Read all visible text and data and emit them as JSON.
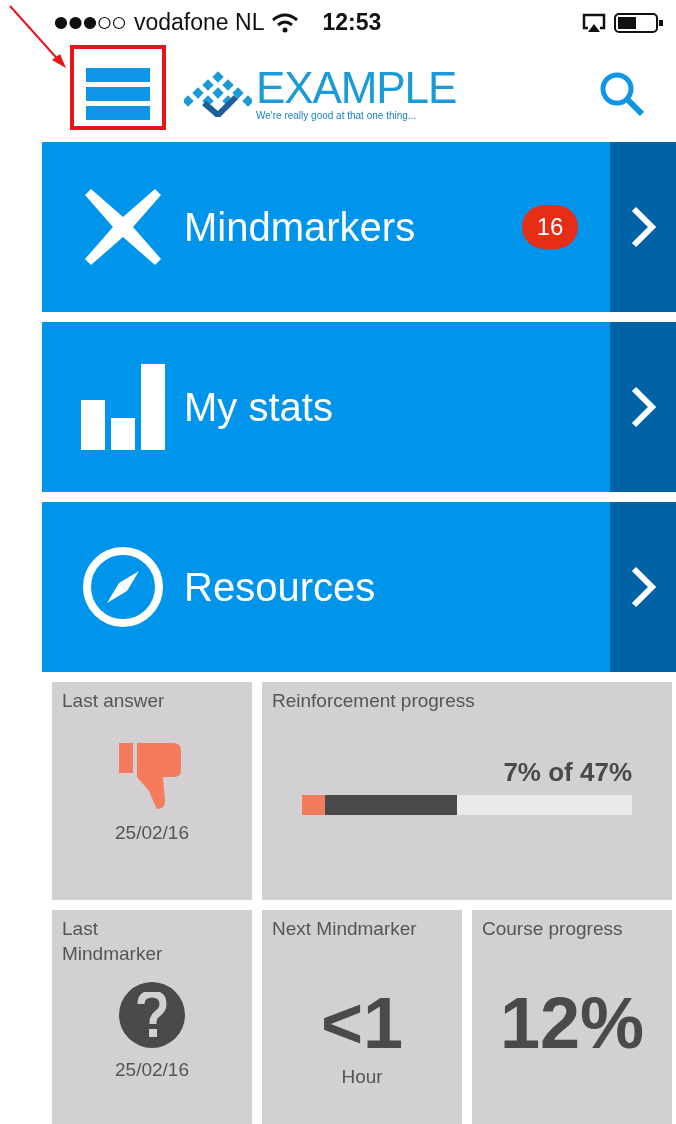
{
  "status_bar": {
    "carrier": "vodafone NL",
    "time": "12:53"
  },
  "header": {
    "logo_text": "EXAMPLE",
    "tagline": "We're really good at that one thing..."
  },
  "menu": [
    {
      "kind": "cross",
      "label": "Mindmarkers",
      "badge": "16"
    },
    {
      "kind": "stats",
      "label": "My stats"
    },
    {
      "kind": "compass",
      "label": "Resources"
    }
  ],
  "tiles": [
    {
      "kind": "answer",
      "title": "Last answer",
      "date": "25/02/16"
    },
    {
      "kind": "progress",
      "title": "Reinforcement progress",
      "reading": "7% of 47%",
      "segments": [
        {
          "level": 0.47,
          "color": "#4a4a4c"
        },
        {
          "level": 0.07,
          "color": "#f47c5c"
        }
      ]
    },
    {
      "kind": "mindmarker",
      "title": "Last Mindmarker",
      "date": "25/02/16"
    },
    {
      "kind": "big",
      "title": "Next Mindmarker",
      "value": "<1",
      "unit": "Hour"
    },
    {
      "kind": "big",
      "title": "Course progress",
      "value": "12%"
    }
  ]
}
